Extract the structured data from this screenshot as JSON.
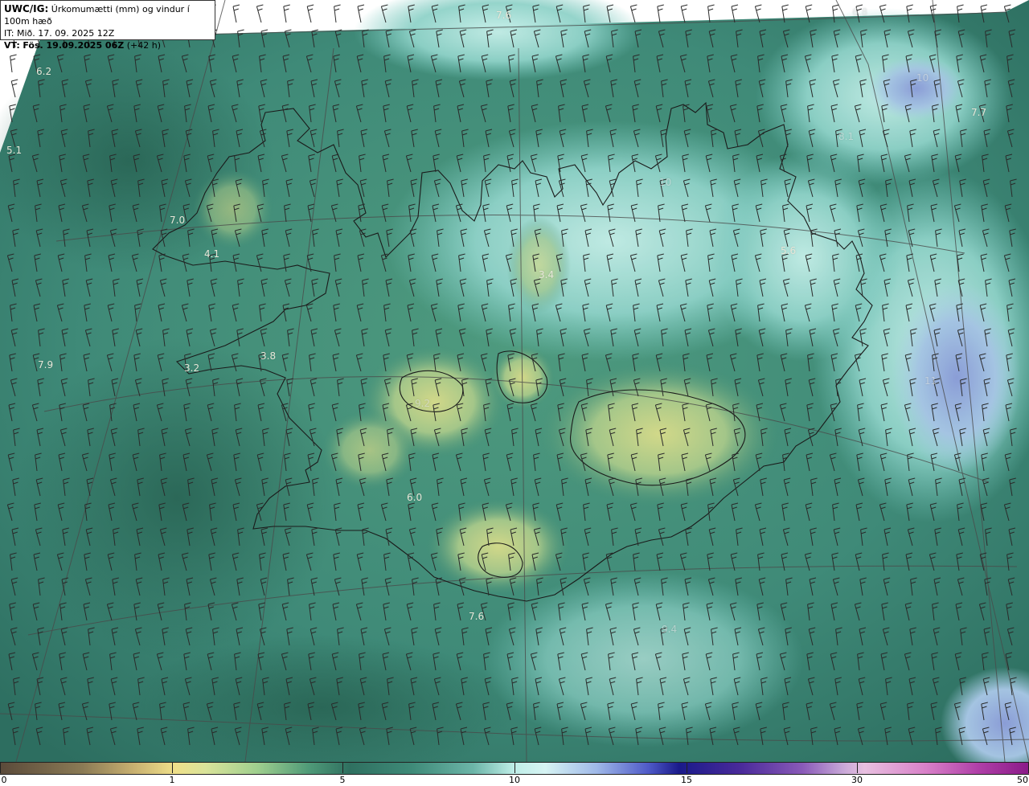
{
  "header": {
    "product": "UWC/IG:",
    "title": "Úrkomumætti (mm) og vindur í 100m hæð",
    "init_time": "IT: Mið. 17. 09. 2025 12Z",
    "valid_prefix": "VT:",
    "valid_time": "Fös. 19.09.2025 06Z",
    "lead_time": "(+42 h)"
  },
  "value_labels": [
    {
      "text": "7.6"
    },
    {
      "text": "6.2"
    },
    {
      "text": "5.1"
    },
    {
      "text": "7.0"
    },
    {
      "text": "4.1"
    },
    {
      "text": "3.4"
    },
    {
      "text": "3.8"
    },
    {
      "text": "3.2"
    },
    {
      "text": "7.9"
    },
    {
      "text": "10"
    },
    {
      "text": "5.6"
    },
    {
      "text": "6.0"
    },
    {
      "text": "7.6"
    },
    {
      "text": "7.7"
    },
    {
      "text": "8.1"
    },
    {
      "text": "10"
    },
    {
      "text": "6.8"
    },
    {
      "text": "9.4"
    },
    {
      "text": "11"
    },
    {
      "text": "9.2"
    }
  ],
  "colorbar": {
    "ticks": [
      "0",
      "1",
      "5",
      "10",
      "15",
      "30",
      "50"
    ],
    "tick_positions": [
      0,
      0.167,
      0.333,
      0.5,
      0.667,
      0.833,
      1.0
    ]
  },
  "colors": {
    "land_outline": "#1a1a1a",
    "barb": "#2a2a2a",
    "grid": "#4a4a4a"
  }
}
